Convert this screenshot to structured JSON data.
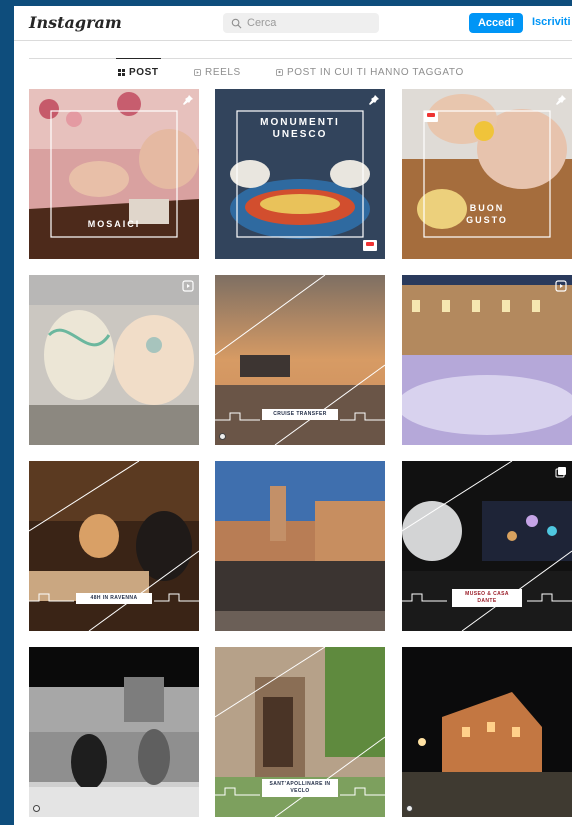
{
  "header": {
    "logo": "Instagram",
    "search_placeholder": "Cerca",
    "login_label": "Accedi",
    "signup_label": "Iscriviti"
  },
  "tabs": [
    {
      "label": "POST",
      "active": true
    },
    {
      "label": "REELS",
      "active": false
    },
    {
      "label": "POST IN CUI TI HANNO TAGGATO",
      "active": false
    }
  ],
  "posts": [
    {
      "caption": "MOSAICI",
      "pinned": true
    },
    {
      "caption": "MONUMENTI UNESCO",
      "pinned": true
    },
    {
      "caption": "BUON GUSTO",
      "pinned": true
    },
    {
      "caption": "",
      "badge": "reel"
    },
    {
      "caption": "CRUISE TRANSFER"
    },
    {
      "caption": "",
      "badge": "reel"
    },
    {
      "caption": "48H IN RAVENNA"
    },
    {
      "caption": ""
    },
    {
      "caption": "MUSEO & CASA DANTE",
      "badge": "carousel"
    },
    {
      "caption": ""
    },
    {
      "caption": "SANT'APOLLINARE IN VECLO"
    },
    {
      "caption": ""
    }
  ]
}
